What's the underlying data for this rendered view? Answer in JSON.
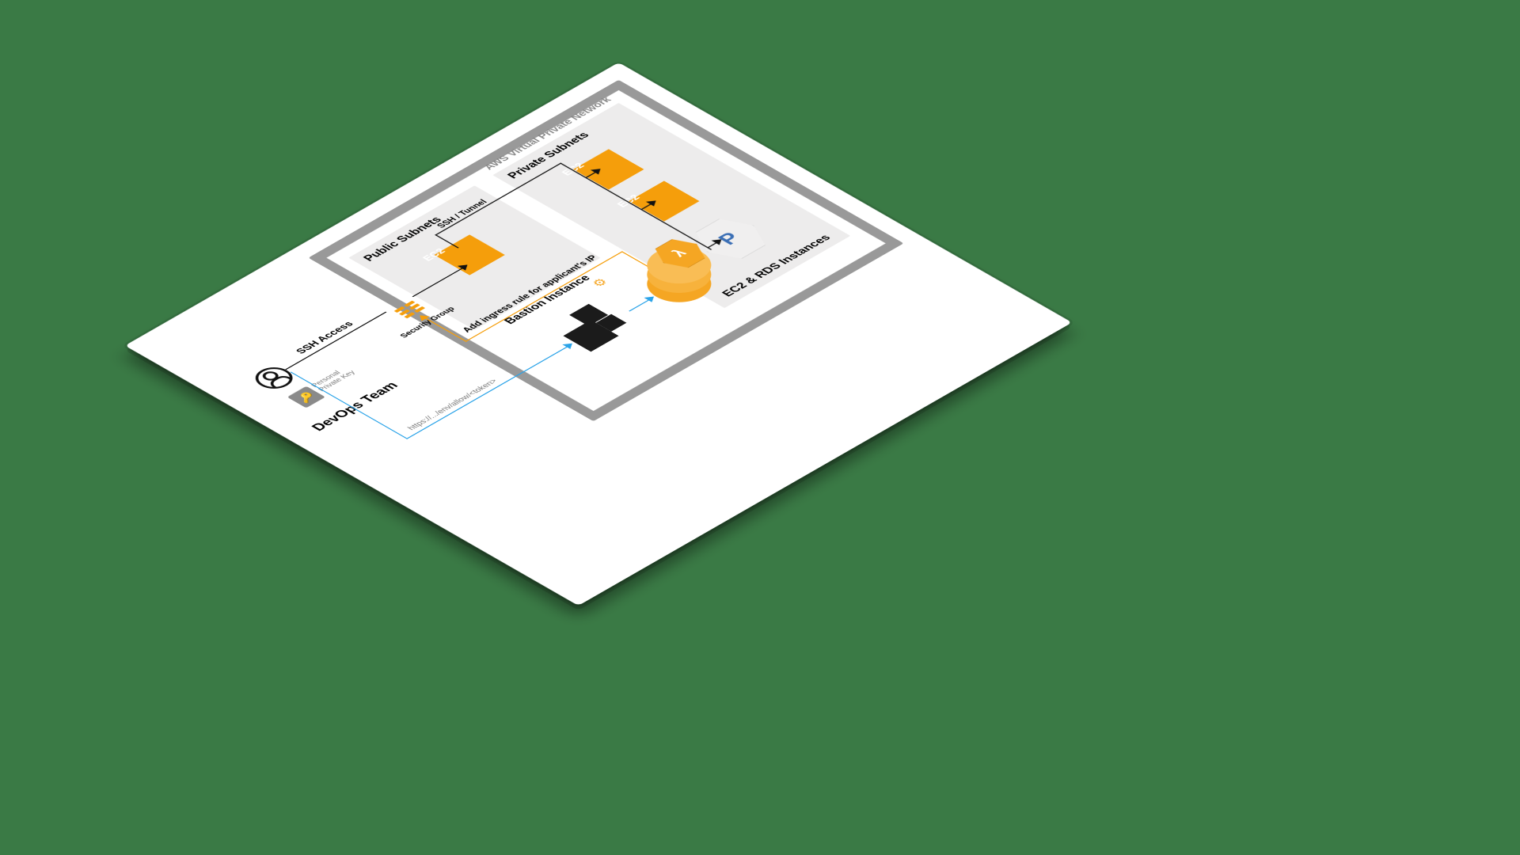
{
  "vpc_label": "AWS Virtual Private Network",
  "public_subnet_title": "Public Subnets",
  "private_subnet_title": "Private Subnets",
  "bastion_label": "Bastion Instance",
  "private_caption": "EC2 & RDS Instances",
  "ec2_label": "EC2",
  "rds_letter": "P",
  "ssh_tunnel_label": "SSH / Tunnel",
  "security_group_label": "Security Group",
  "ssh_access_label": "SSH Access",
  "ingress_label": "Add ingress rule for applicant's IP",
  "personal_key_label": "Personal\nPrivate Key",
  "devops_label": "DevOps Team",
  "url_label": "https://.../env/allow/<token>",
  "lambda_symbol": "λ",
  "gear_symbol": "⚙"
}
